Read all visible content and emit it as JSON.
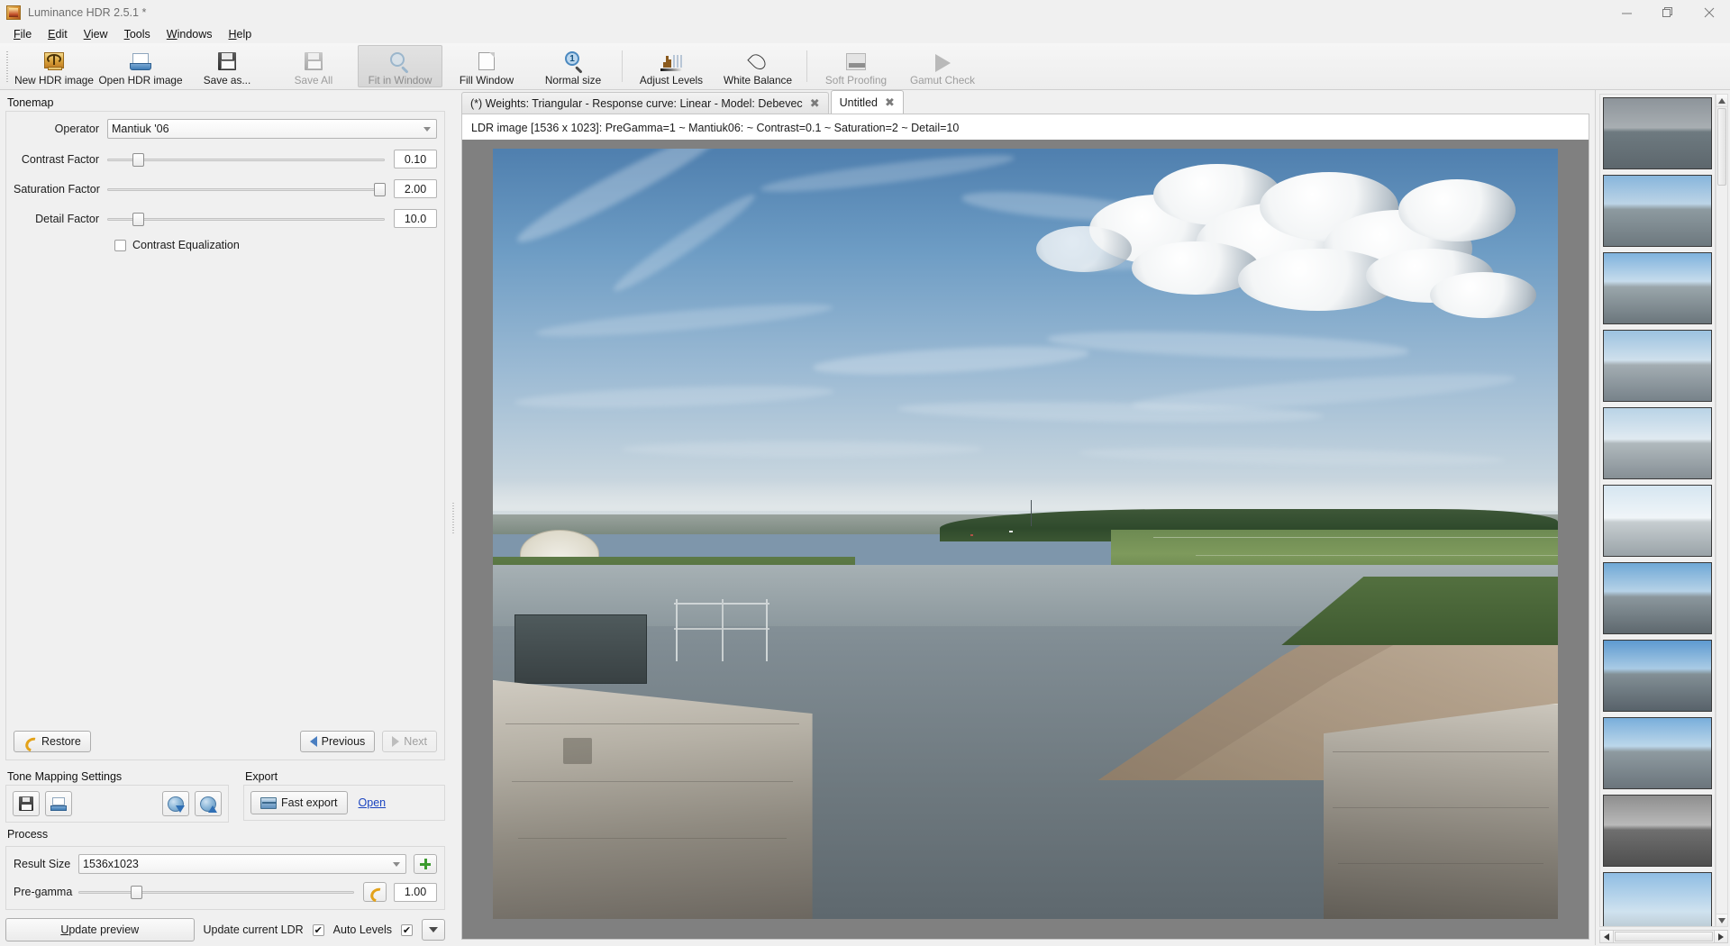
{
  "window": {
    "title": "Luminance HDR 2.5.1 *",
    "app_icon": "luminance-app-icon",
    "minimize": "—",
    "maximize": "❐",
    "close": "✕"
  },
  "menubar": {
    "items": [
      {
        "label": "File",
        "mnemonic": "F"
      },
      {
        "label": "Edit",
        "mnemonic": "E"
      },
      {
        "label": "View",
        "mnemonic": "V"
      },
      {
        "label": "Tools",
        "mnemonic": "T"
      },
      {
        "label": "Windows",
        "mnemonic": "W"
      },
      {
        "label": "Help",
        "mnemonic": "H"
      }
    ]
  },
  "toolbar": {
    "buttons": [
      {
        "label": "New HDR image",
        "icon": "new-hdr-image-icon",
        "state": "enabled"
      },
      {
        "label": "Open HDR image",
        "icon": "open-hdr-image-icon",
        "state": "enabled"
      },
      {
        "label": "Save as...",
        "icon": "save-as-icon",
        "state": "enabled"
      },
      {
        "label": "Save All",
        "icon": "save-all-icon",
        "state": "disabled"
      },
      {
        "label": "Fit in Window",
        "icon": "fit-in-window-icon",
        "state": "active"
      },
      {
        "label": "Fill Window",
        "icon": "fill-window-icon",
        "state": "enabled"
      },
      {
        "label": "Normal size",
        "icon": "normal-size-icon",
        "state": "enabled",
        "badge": "1"
      },
      {
        "label": "Adjust Levels",
        "icon": "adjust-levels-icon",
        "state": "enabled"
      },
      {
        "label": "White Balance",
        "icon": "white-balance-icon",
        "state": "enabled"
      },
      {
        "label": "Soft Proofing",
        "icon": "soft-proofing-icon",
        "state": "disabled"
      },
      {
        "label": "Gamut Check",
        "icon": "gamut-check-icon",
        "state": "disabled"
      }
    ]
  },
  "left_panel": {
    "tonemap": {
      "group_label": "Tonemap",
      "operator_label": "Operator",
      "operator_value": "Mantiuk '06",
      "sliders": [
        {
          "label": "Contrast Factor",
          "value": "0.10",
          "position_pct": 10
        },
        {
          "label": "Saturation Factor",
          "value": "2.00",
          "position_pct": 98
        },
        {
          "label": "Detail Factor",
          "value": "10.0",
          "position_pct": 10
        }
      ],
      "checkbox_label": "Contrast Equalization",
      "checkbox_checked": false,
      "restore_label": "Restore",
      "previous_label": "Previous",
      "next_label": "Next",
      "next_disabled": true
    },
    "tone_mapping_settings": {
      "group_label": "Tone Mapping Settings",
      "buttons": [
        {
          "icon": "save-settings-icon",
          "name": "save-settings-button"
        },
        {
          "icon": "load-settings-icon",
          "name": "load-settings-button"
        },
        {
          "icon": "download-settings-icon",
          "name": "download-settings-button"
        },
        {
          "icon": "upload-settings-icon",
          "name": "upload-settings-button"
        }
      ]
    },
    "export": {
      "group_label": "Export",
      "fast_export_label": "Fast export",
      "fast_export_icon": "fast-export-icon",
      "open_link_label": "Open"
    },
    "process": {
      "group_label": "Process",
      "result_size_label": "Result Size",
      "result_size_value": "1536x1023",
      "add_size_icon": "add-size-icon",
      "pregamma_label": "Pre-gamma",
      "pregamma_value": "1.00",
      "pregamma_position_pct": 20,
      "reset_pregamma_icon": "reset-pregamma-icon",
      "update_preview_label": "Update preview",
      "update_current_ldr_label": "Update current LDR",
      "update_current_ldr_checked": true,
      "auto_levels_label": "Auto Levels",
      "auto_levels_checked": true,
      "dropdown_icon": "chevron-down-icon"
    }
  },
  "center": {
    "tabs": [
      {
        "label": "(*) Weights: Triangular - Response curve: Linear - Model: Debevec",
        "selected": false,
        "close_icon": "close-icon"
      },
      {
        "label": "Untitled",
        "selected": true,
        "close_icon": "close-icon"
      }
    ],
    "ldr_caption": "LDR image [1536 x 1023]: PreGamma=1 ~ Mantiuk06: ~ Contrast=0.1 ~ Saturation=2 ~ Detail=10",
    "photo_alt": "HDR tone-mapped photo of a tidal river channel with stone lock walls, sandbanks, green fields and a blue sky with cumulus clouds"
  },
  "right_panel": {
    "name": "ldr-thumbnail-list",
    "thumbnails": [
      {
        "name": "thumbnail-1",
        "style": "muted-gray"
      },
      {
        "name": "thumbnail-2",
        "style": "bright-blue"
      },
      {
        "name": "thumbnail-3",
        "style": "vivid-blue"
      },
      {
        "name": "thumbnail-4",
        "style": "soft-blue"
      },
      {
        "name": "thumbnail-5",
        "style": "light-haze"
      },
      {
        "name": "thumbnail-6",
        "style": "pale-white"
      },
      {
        "name": "thumbnail-7",
        "style": "contrasty-blue"
      },
      {
        "name": "thumbnail-8",
        "style": "deep-blue"
      },
      {
        "name": "thumbnail-9",
        "style": "colored-fringe"
      },
      {
        "name": "thumbnail-10",
        "style": "grayscale"
      },
      {
        "name": "thumbnail-11",
        "style": "sky-blue"
      }
    ],
    "scroll_up_icon": "scroll-up-icon",
    "scroll_down_icon": "scroll-down-icon",
    "scroll_left_icon": "scroll-left-icon",
    "scroll_right_icon": "scroll-right-icon"
  },
  "colors": {
    "window_bg": "#f0f0f0",
    "toolbar_bg": "#ededed",
    "viewport_bg": "#808080",
    "link": "#1a44c0",
    "accent_blue": "#4a7fc1",
    "green_plus": "#3b9a2e",
    "amber": "#e3a21a"
  }
}
